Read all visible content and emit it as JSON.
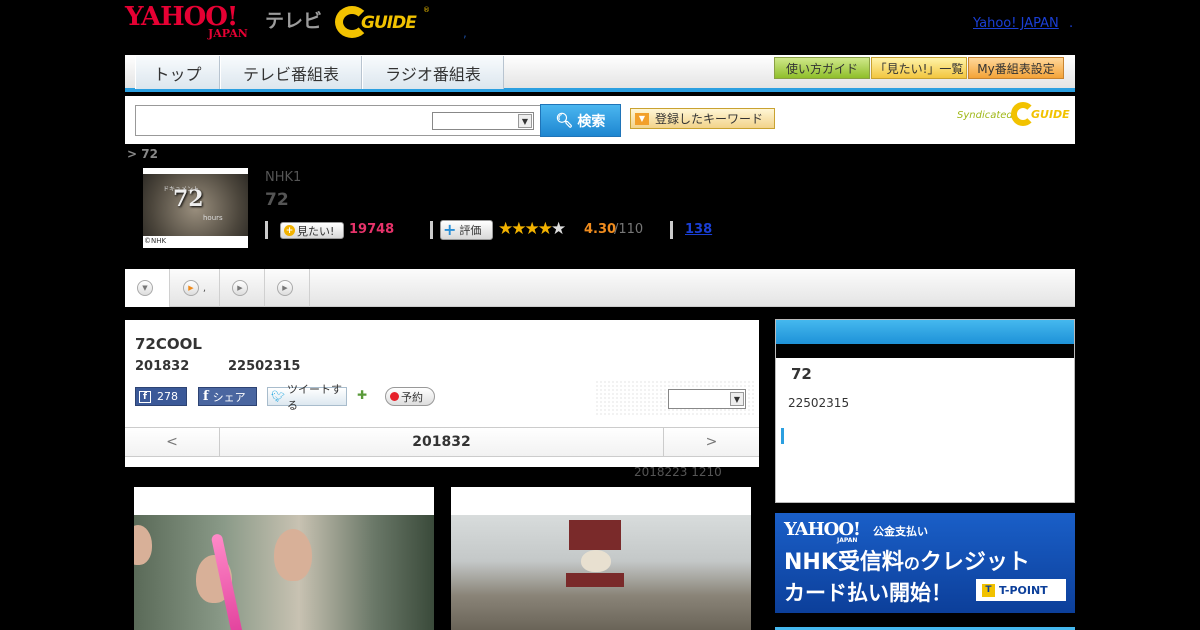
{
  "header": {
    "yahoo_logo": "YAHOO!",
    "japan_logo": "JAPAN",
    "tv_logo": "テレビ",
    "gguide_logo": "GUIDE",
    "gguide_reg": "®",
    "dot": ",",
    "yahoo_japan_link": "Yahoo! JAPAN",
    "link_dot": "."
  },
  "nav": {
    "tabs": [
      {
        "label": "トップ"
      },
      {
        "label": "テレビ番組表"
      },
      {
        "label": "ラジオ番組表"
      }
    ],
    "buttons": [
      {
        "label": "使い方ガイド"
      },
      {
        "label": "「見たい!」一覧"
      },
      {
        "label": "My番組表設定"
      }
    ]
  },
  "search": {
    "input_value": "",
    "select_value": "",
    "button_label": "検索",
    "keywords_label": "登録したキーワード",
    "syndicated": "Syndicated",
    "syndicated_logo": "GUIDE"
  },
  "breadcrumb": "> 72",
  "program": {
    "thumb_small": "ドキュメント",
    "thumb_number": "72",
    "thumb_hours": "hours",
    "thumb_copyright": "©NHK",
    "channel": "NHK1",
    "title": "72",
    "mitai_label": "見たい!",
    "mitai_count": "19748",
    "hyoka_label": "評価",
    "stars_filled": "★★★★",
    "stars_empty": "★",
    "rating": "4.30",
    "rating_total": "/110",
    "review_count": "138"
  },
  "tabs": [
    {
      "label": ""
    },
    {
      "label": ","
    },
    {
      "label": ""
    },
    {
      "label": ""
    }
  ],
  "episode": {
    "title": "72COOL",
    "date": "201832",
    "time": "22502315",
    "fb_like_count": "278",
    "fb_share_label": "シェア",
    "tweet_label": "ツイートする",
    "yoyaku_label": "予約",
    "select_value": "",
    "pager_prev": "<",
    "pager_label": "201832",
    "pager_next": ">",
    "updated": "2018223  1210"
  },
  "sidebar": {
    "title": "72",
    "time": "22502315"
  },
  "banner": {
    "yahoo": "YAHOO!",
    "japan": "JAPAN",
    "kokin": "公金支払い",
    "line1_a": "NHK受信料",
    "line1_b": "の",
    "line1_c": "クレジット",
    "line2": "カード払い開始！",
    "tpoint": "T-POINT",
    "tpoint_t": "T"
  },
  "colors": {
    "accent_blue": "#2b9fe0",
    "yahoo_red": "#e60033",
    "mitai_pink": "#e6336a",
    "rating_orange": "#f08c1e",
    "link_blue": "#1a3fd6"
  }
}
